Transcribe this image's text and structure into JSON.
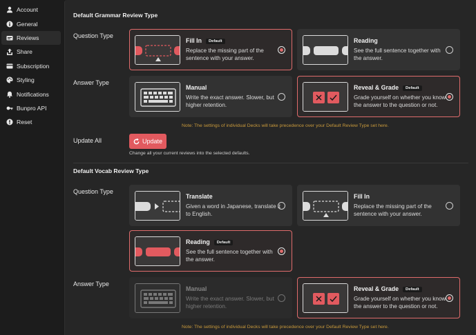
{
  "sidebar": {
    "items": [
      {
        "label": "Account",
        "icon": "account-icon",
        "active": false
      },
      {
        "label": "General",
        "icon": "info-icon",
        "active": false
      },
      {
        "label": "Reviews",
        "icon": "card-icon",
        "active": true
      },
      {
        "label": "Share",
        "icon": "share-icon",
        "active": false
      },
      {
        "label": "Subscription",
        "icon": "subscription-icon",
        "active": false
      },
      {
        "label": "Styling",
        "icon": "palette-icon",
        "active": false
      },
      {
        "label": "Notifications",
        "icon": "bell-icon",
        "active": false
      },
      {
        "label": "Bunpro API",
        "icon": "key-icon",
        "active": false
      },
      {
        "label": "Reset",
        "icon": "alert-icon",
        "active": false
      }
    ]
  },
  "grammar": {
    "title": "Default Grammar Review Type",
    "question_label": "Question Type",
    "answer_label": "Answer Type",
    "fill_in": {
      "title": "Fill In",
      "badge": "Default",
      "desc": "Replace the missing part of the sentence with your answer.",
      "selected": true
    },
    "reading": {
      "title": "Reading",
      "desc": "See the full sentence together with the answer.",
      "selected": false
    },
    "manual": {
      "title": "Manual",
      "desc": "Write the exact answer. Slower, but higher retention.",
      "selected": false
    },
    "reveal": {
      "title": "Reveal & Grade",
      "badge": "Default",
      "desc": "Grade yourself on whether you know the answer to the question or not.",
      "selected": true
    },
    "note": "Note: The settings of individual Decks will take precedence over your Default Review Type set here."
  },
  "update_all": {
    "label": "Update All",
    "button": "Update",
    "desc": "Change all your current reviews into the selected defaults."
  },
  "vocab": {
    "title": "Default Vocab Review Type",
    "question_label": "Question Type",
    "answer_label": "Answer Type",
    "translate": {
      "title": "Translate",
      "desc": "Given a word in Japanese, translate it to English.",
      "selected": false
    },
    "fill_in": {
      "title": "Fill In",
      "desc": "Replace the missing part of the sentence with your answer.",
      "selected": false
    },
    "reading": {
      "title": "Reading",
      "badge": "Default",
      "desc": "See the full sentence together with the answer.",
      "selected": true
    },
    "manual": {
      "title": "Manual",
      "desc": "Write the exact answer. Slower, but higher retention.",
      "selected": false
    },
    "reveal": {
      "title": "Reveal & Grade",
      "badge": "Default",
      "desc": "Grade yourself on whether you know the answer to the question or not.",
      "selected": true
    },
    "note": "Note: The settings of individual Decks will take precedence over your Default Review Type set here."
  },
  "colors": {
    "accent": "#e25a5f",
    "note": "#c99a3c",
    "panel": "#262626",
    "card": "#323232"
  }
}
